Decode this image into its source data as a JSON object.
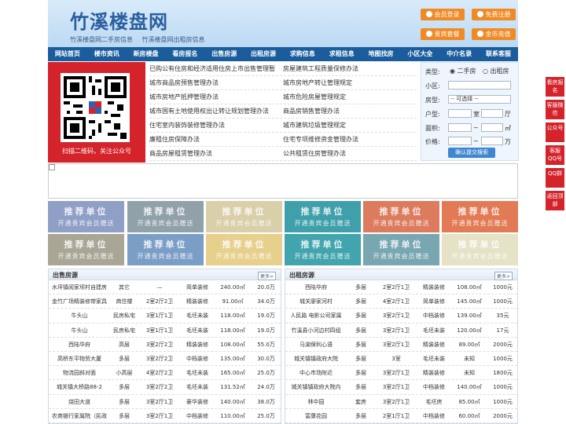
{
  "header": {
    "logo": "竹溪楼盘网",
    "sublinks": [
      "竹溪楼盘网二手房信息",
      "竹溪楼盘网出租房信息"
    ],
    "buttons": [
      "会员登录",
      "免费注册",
      "贵宾套餐",
      "金币充值"
    ]
  },
  "nav": [
    "网站首页",
    "楼市资讯",
    "新房楼盘",
    "看房报名",
    "出售房源",
    "出租房源",
    "求购信息",
    "求租信息",
    "地图找房",
    "小区大全",
    "中介名录",
    "联系客服"
  ],
  "qr": {
    "text": "扫描二维码，关注公众号"
  },
  "policies": [
    [
      "已购公有住房和经济适用住房上市出售管理暂",
      "房屋建筑工程质量保修办法"
    ],
    [
      "城市商品房预售管理办法",
      "城市房地产转让管理规定"
    ],
    [
      "城市房地产抵押管理办法",
      "城市危险房屋管理规定"
    ],
    [
      "城市国有土地使用权出让转让规划管理办法",
      "商品房销售管理办法"
    ],
    [
      "住宅室内装饰装修管理办法",
      "城市建筑垃圾管理规定"
    ],
    [
      "廉租住房保障办法",
      "住宅专项维修资金管理办法"
    ],
    [
      "商品房屋租赁管理办法",
      "公共租赁住房管理办法"
    ]
  ],
  "search": {
    "type_label": "类型:",
    "opt1": "二手房",
    "opt2": "出租房",
    "xq_label": "小区:",
    "fx_label": "房型:",
    "fx_value": "-- 可选择 --",
    "hx_label": "户型:",
    "shi": "室",
    "ting": "厅",
    "area_label": "面积:",
    "price_label": "价格:",
    "sep": "~",
    "area_unit": "㎡",
    "price_unit": "万",
    "submit": "确认提交搜索"
  },
  "rec": {
    "t1": "推荐单位",
    "t2": "开通贵宾会员赠送",
    "colors": [
      "#8f9fc6",
      "#91a1aa",
      "#d9cfa9",
      "#3fa0ab",
      "#dc7b5d",
      "#e27b55",
      "#a9a695",
      "#7b9ec6",
      "#e7cf8c",
      "#42a4ad",
      "#78a6b1",
      "#e6e2c6"
    ]
  },
  "sale": {
    "title": "出售房源",
    "more": "更多>",
    "rows": [
      [
        "水坪镇阅家坝村自建房",
        "其它",
        "—",
        "简单装修",
        "240.00㎡",
        "20.0万"
      ],
      [
        "金竹广场精装修带家具",
        "商住楼",
        "2室2厅2卫",
        "精装装修",
        "91.00㎡",
        "34.0万"
      ],
      [
        "牛头山",
        "民房私宅",
        "3室1厅1卫",
        "毛坯未装",
        "118.00㎡",
        "19.0万"
      ],
      [
        "牛头山",
        "民房私宅",
        "3室1厅1卫",
        "毛坯未装",
        "118.00㎡",
        "19.0万"
      ],
      [
        "西陆华府",
        "高层",
        "3室2厅2卫",
        "精装装修",
        "108.00㎡",
        "55.0万"
      ],
      [
        "高桥东平物贸大厦",
        "多层",
        "3室2厅2卫",
        "中档装修",
        "135.00㎡",
        "30.0万"
      ],
      [
        "物流园斜对面",
        "小高层",
        "4室2厅2卫",
        "毛坯未装",
        "165.00㎡",
        "25.0万"
      ],
      [
        "城关镇大桥路88-2",
        "多层",
        "3室2厅2卫",
        "毛坯未装",
        "131.52㎡",
        "24.0万"
      ],
      [
        "烧田大道",
        "多层",
        "3室2厅1卫",
        "豪华装修",
        "140.00㎡",
        "38.0万"
      ],
      [
        "农商银行家属院（民政",
        "多层",
        "3室2厅1卫",
        "中档装修",
        "110.00㎡",
        "25.0万"
      ]
    ]
  },
  "rent": {
    "title": "出租房源",
    "more": "更多>",
    "rows": [
      [
        "西陆华府",
        "多层",
        "2室2厅1卫",
        "精装装修",
        "108.00㎡",
        "1000元"
      ],
      [
        "城关廖家河村",
        "多层",
        "4室2厅1卫",
        "简单装修",
        "145.00㎡",
        "1000元"
      ],
      [
        "人民路 电影公司家属",
        "多层",
        "3室2厅1卫",
        "中档装修",
        "139.00㎡",
        "35元"
      ],
      [
        "竹溪县小河边村四组",
        "多层",
        "3室2厅1卫",
        "毛坯未装",
        "120.00㎡",
        "17元"
      ],
      [
        "马湖保利心语",
        "多层",
        "3室2厅1卫",
        "精装装修",
        "89.00㎡",
        "2000元"
      ],
      [
        "城关镇镇政府大院",
        "多层",
        "3室",
        "毛坯未装",
        "未知",
        "1000元"
      ],
      [
        "中心市场附近",
        "多层",
        "3室2厅1卫",
        "精装装修",
        "未知",
        "1800元"
      ],
      [
        "城关镇镇政府大院内",
        "多层",
        "3室2厅1卫",
        "中档装修",
        "140.00㎡",
        "1000元"
      ],
      [
        "林中园",
        "套房",
        "3室2厅1卫",
        "毛坯房",
        "85.00㎡",
        "1000元"
      ],
      [
        "富康花园",
        "多层",
        "2室1厅1卫",
        "中档装修",
        "60.00㎡",
        "2000元"
      ]
    ]
  },
  "side": [
    "看房报名",
    "客服微信",
    "公众号",
    "客服QQ号",
    "QQ群",
    "返回顶部"
  ]
}
